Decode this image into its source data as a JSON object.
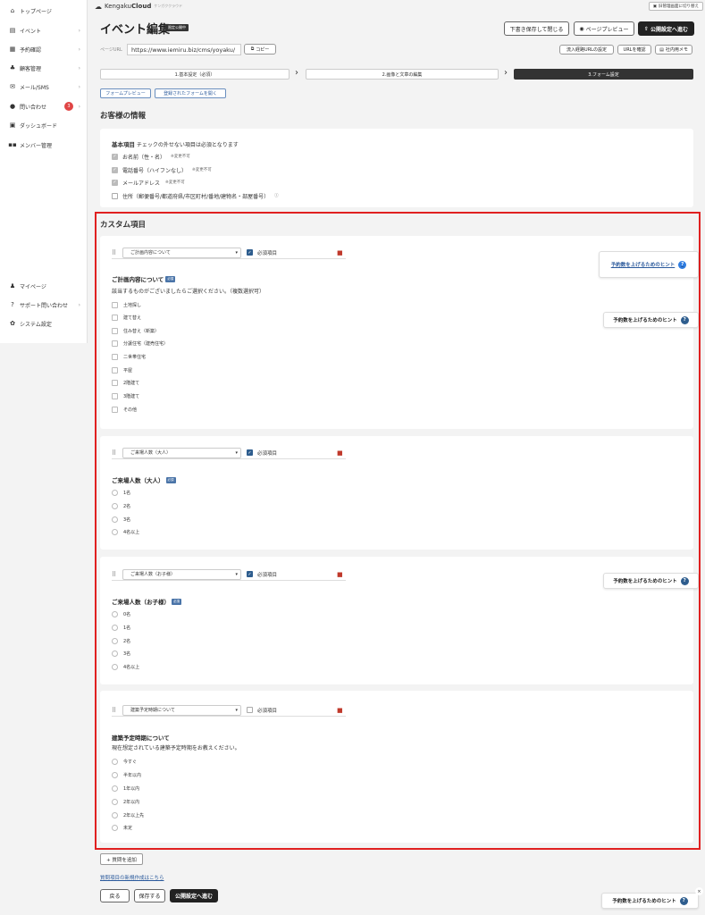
{
  "sidebar": {
    "items": [
      {
        "label": "トップページ",
        "icon": "home-icon",
        "glyph": "⌂"
      },
      {
        "label": "イベント",
        "icon": "file-icon",
        "glyph": "▤",
        "chevron": "›"
      },
      {
        "label": "予約確認",
        "icon": "calendar-icon",
        "glyph": "▦",
        "chevron": "›"
      },
      {
        "label": "顧客管理",
        "icon": "users-icon",
        "glyph": "♣",
        "chevron": "›"
      },
      {
        "label": "メール/SMS",
        "icon": "mail-icon",
        "glyph": "✉",
        "chevron": "›"
      },
      {
        "label": "問い合わせ",
        "icon": "chat-icon",
        "glyph": "●",
        "badge": "3",
        "chevron": "›"
      },
      {
        "label": "ダッシュボード",
        "icon": "chart-icon",
        "glyph": "▣"
      },
      {
        "label": "メンバー管理",
        "icon": "grid-icon",
        "glyph": "▪▪"
      }
    ],
    "bottom_items": [
      {
        "label": "マイページ",
        "icon": "person-icon",
        "glyph": "♟"
      },
      {
        "label": "サポート問い合わせ",
        "icon": "help-icon",
        "glyph": "?",
        "chevron": "›"
      },
      {
        "label": "システム設定",
        "icon": "gear-icon",
        "glyph": "✿"
      }
    ]
  },
  "header": {
    "logo_main": "Kengaku",
    "logo_bold": "Cloud",
    "logo_kana": "ケンガククラウド",
    "switch_label": "旧管理画面に切り替え"
  },
  "page": {
    "title": "イベント編集",
    "status": "限定公開中",
    "save_draft": "下書き保存して閉じる",
    "preview": "ページプレビュー",
    "publish_next": "公開設定へ進む",
    "url_label": "ページURL",
    "url_value": "https://www.iemiru.biz/cms/yoyaku/",
    "copy": "コピー",
    "inflow_url": "流入経路URLの設定",
    "confirm_url": "URLを確認",
    "internal_memo": "社内用メモ"
  },
  "steps": [
    "1.基本設定（必須）",
    "2.画像と文章の編集",
    "3.フォーム設定"
  ],
  "tools": {
    "form_preview": "フォームプレビュー",
    "open_registered": "登録されたフォームを開く"
  },
  "customer_info": {
    "section_title": "お客様の情報",
    "basic_title": "基本項目",
    "basic_note": "チェックの外せない項目は必須となります",
    "rows": [
      {
        "label": "お名前（性・名）",
        "note": "※変更不可"
      },
      {
        "label": "電話番号（ハイフンなし）",
        "note": "※変更不可"
      },
      {
        "label": "メールアドレス",
        "note": "※変更不可"
      },
      {
        "label": "住所（郵便番号/都道府県/市区町村/番地/建物名・部屋番号）",
        "note": "ⓘ"
      }
    ]
  },
  "custom": {
    "section_title": "カスタム項目",
    "required_label": "必須項目",
    "required_badge": "必須",
    "questions": [
      {
        "select": "ご計画内容について",
        "title": "ご計画内容について",
        "desc": "該当するものがございましたらご選択ください。（複数選択可）",
        "options": [
          "土地探し",
          "建て替え",
          "住み替え（新築）",
          "分譲住宅（建売住宅）",
          "二世帯住宅",
          "平屋",
          "2階建て",
          "3階建て",
          "その他"
        ]
      },
      {
        "select": "ご来場人数（大人）",
        "title": "ご来場人数（大人）",
        "options": [
          "1名",
          "2名",
          "3名",
          "4名以上"
        ]
      },
      {
        "select": "ご来場人数（お子様）",
        "title": "ご来場人数（お子様）",
        "options": [
          "0名",
          "1名",
          "2名",
          "3名",
          "4名以上"
        ]
      },
      {
        "select": "建築予定時期について",
        "title": "建築予定時期について",
        "desc": "現在想定されている建築予定時期をお教えください。",
        "options": [
          "今すぐ",
          "半年以内",
          "1年以内",
          "2年以内",
          "2年以上先",
          "未定"
        ]
      }
    ]
  },
  "hint": "予約数を上げるためのヒント",
  "footer": {
    "add_question": "+ 質問を追加",
    "new_link": "質問項目の新規作成はこちら",
    "back": "戻る",
    "save": "保存する",
    "publish_next": "公開設定へ進む"
  },
  "colors": {
    "accent": "#2e5d8e",
    "highlight": "#e02020",
    "danger": "#c0392b",
    "link": "#2b5a9c"
  }
}
